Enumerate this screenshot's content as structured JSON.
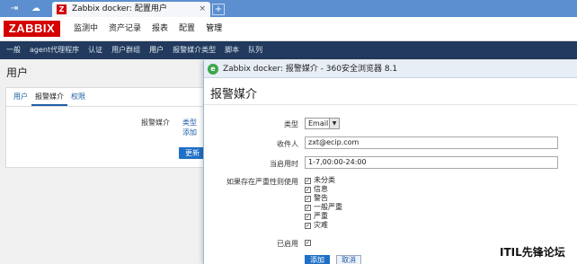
{
  "browser": {
    "tab_title": "Zabbix docker: 配置用户",
    "tab_close": "×",
    "new_tab": "+",
    "logo_letter": "Z"
  },
  "header": {
    "logo": "ZABBIX",
    "menu": [
      {
        "label": "监测中"
      },
      {
        "label": "资产记录"
      },
      {
        "label": "报表"
      },
      {
        "label": "配置"
      },
      {
        "label": "管理"
      }
    ]
  },
  "subnav": [
    {
      "label": "一般"
    },
    {
      "label": "agent代理程序"
    },
    {
      "label": "认证"
    },
    {
      "label": "用户群组"
    },
    {
      "label": "用户"
    },
    {
      "label": "报警媒介类型"
    },
    {
      "label": "脚本"
    },
    {
      "label": "队列"
    }
  ],
  "page": {
    "title": "用户",
    "tabs": [
      {
        "label": "用户"
      },
      {
        "label": "报警媒介"
      },
      {
        "label": "权限"
      }
    ],
    "media_label": "报警媒介",
    "type_link": "类型",
    "add_link": "添加",
    "update_button": "更新"
  },
  "popup": {
    "window_title": "Zabbix docker: 报警媒介 - 360安全浏览器 8.1",
    "heading": "报警媒介",
    "type_label": "类型",
    "type_value": "Email",
    "send_to_label": "收件人",
    "send_to_value": "zxt@ecip.com",
    "when_active_label": "当启用时",
    "when_active_value": "1-7,00:00-24:00",
    "severity_label": "如果存在严重性则使用",
    "severities": [
      {
        "label": "未分类",
        "checked": true
      },
      {
        "label": "信息",
        "checked": true
      },
      {
        "label": "警告",
        "checked": true
      },
      {
        "label": "一般严重",
        "checked": true
      },
      {
        "label": "严重",
        "checked": true
      },
      {
        "label": "灾难",
        "checked": true
      }
    ],
    "enabled_label": "已启用",
    "enabled": true,
    "add_button": "添加",
    "cancel_button": "取消"
  },
  "watermark": "ITIL先锋论坛",
  "colors": {
    "brand_red": "#d40000",
    "nav_dark": "#213a5e",
    "link_blue": "#1f5fa8",
    "button_blue": "#1f6fc5"
  }
}
